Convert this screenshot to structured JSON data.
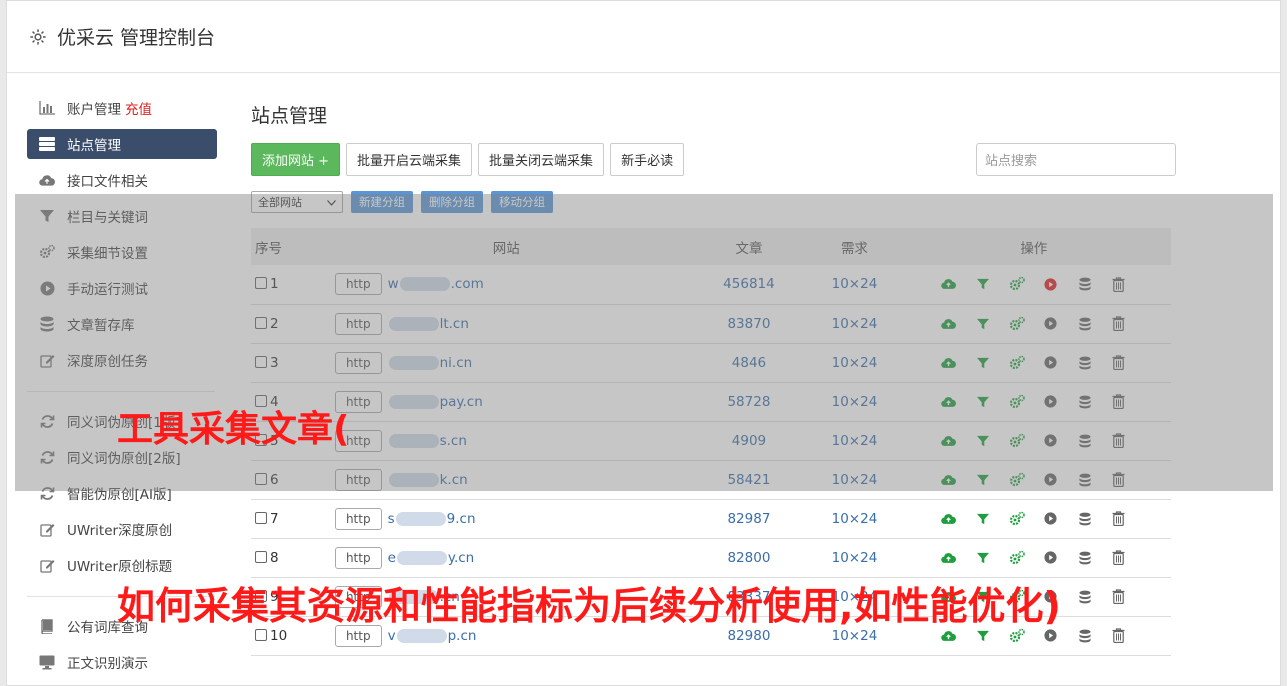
{
  "header": {
    "title": "优采云 管理控制台",
    "icon": "gear-icon"
  },
  "sidebar": {
    "items": [
      {
        "label": "账户管理",
        "extra": "充值",
        "icon": "bar-chart-icon"
      },
      {
        "label": "站点管理",
        "icon": "server-list-icon",
        "active": true
      },
      {
        "label": "接口文件相关",
        "icon": "cloud-upload-icon"
      },
      {
        "label": "栏目与关键词",
        "icon": "filter-icon"
      },
      {
        "label": "采集细节设置",
        "icon": "cogs-icon"
      },
      {
        "label": "手动运行测试",
        "icon": "play-circle-icon"
      },
      {
        "label": "文章暂存库",
        "icon": "database-icon"
      },
      {
        "label": "深度原创任务",
        "icon": "edit-icon"
      }
    ],
    "items2": [
      {
        "label": "同义词伪原创[1版]",
        "icon": "refresh-icon"
      },
      {
        "label": "同义词伪原创[2版]",
        "icon": "refresh-icon"
      },
      {
        "label": "智能伪原创[AI版]",
        "icon": "refresh-icon"
      },
      {
        "label": "UWriter深度原创",
        "icon": "edit-icon"
      },
      {
        "label": "UWriter原创标题",
        "icon": "edit-icon"
      }
    ],
    "items3": [
      {
        "label": "公有词库查询",
        "icon": "book-icon"
      },
      {
        "label": "正文识别演示",
        "icon": "monitor-icon"
      }
    ]
  },
  "main": {
    "title": "站点管理",
    "add_site": "添加网站 +",
    "batch_open": "批量开启云端采集",
    "batch_close": "批量关闭云端采集",
    "newbie": "新手必读",
    "search_placeholder": "站点搜索",
    "group_select": "全部网站",
    "new_group": "新建分组",
    "delete_group": "删除分组",
    "move_group": "移动分组"
  },
  "table": {
    "headers": {
      "idx": "序号",
      "site": "网站",
      "articles": "文章",
      "demand": "需求",
      "ops": "操作"
    },
    "rows": [
      {
        "idx": "1",
        "proto": "http",
        "pre": "w",
        "post": ".com",
        "articles": "456814",
        "demand": "10×24",
        "running": true
      },
      {
        "idx": "2",
        "proto": "http",
        "pre": "",
        "post": "lt.cn",
        "articles": "83870",
        "demand": "10×24",
        "running": false
      },
      {
        "idx": "3",
        "proto": "http",
        "pre": "",
        "post": "ni.cn",
        "articles": "4846",
        "demand": "10×24",
        "running": false
      },
      {
        "idx": "4",
        "proto": "http",
        "pre": "",
        "post": "pay.cn",
        "articles": "58728",
        "demand": "10×24",
        "running": false
      },
      {
        "idx": "5",
        "proto": "http",
        "pre": "",
        "post": "s.cn",
        "articles": "4909",
        "demand": "10×24",
        "running": false
      },
      {
        "idx": "6",
        "proto": "http",
        "pre": "",
        "post": "k.cn",
        "articles": "58421",
        "demand": "10×24",
        "running": false
      },
      {
        "idx": "7",
        "proto": "http",
        "pre": "s",
        "post": "9.cn",
        "articles": "82987",
        "demand": "10×24",
        "running": false
      },
      {
        "idx": "8",
        "proto": "http",
        "pre": "e",
        "post": "y.cn",
        "articles": "82800",
        "demand": "10×24",
        "running": false
      },
      {
        "idx": "9",
        "proto": "http",
        "pre": "",
        "post": ".cn",
        "articles": "83337",
        "demand": "10×24",
        "running": false
      },
      {
        "idx": "10",
        "proto": "http",
        "pre": "v",
        "post": "p.cn",
        "articles": "82980",
        "demand": "10×24",
        "running": false
      }
    ]
  },
  "overlay": {
    "caption1": "工具采集文章(",
    "caption2": "如何采集其资源和性能指标为后续分析使用,如性能优化)"
  },
  "colors": {
    "green": "#1e9e3e",
    "blue": "#3a6ea8",
    "red": "#e02020",
    "active_nav": "#3a4d6b"
  }
}
